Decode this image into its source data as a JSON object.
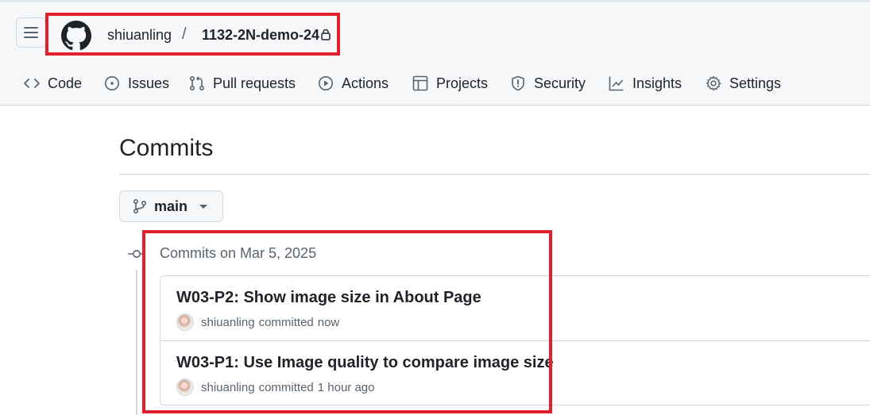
{
  "header": {
    "owner": "shiuanling",
    "separator": "/",
    "repo": "1132-2N-demo-24",
    "nav_tabs": [
      {
        "label": "Code",
        "icon": "code-icon"
      },
      {
        "label": "Issues",
        "icon": "issue-opened-icon"
      },
      {
        "label": "Pull requests",
        "icon": "git-pull-request-icon"
      },
      {
        "label": "Actions",
        "icon": "play-icon"
      },
      {
        "label": "Projects",
        "icon": "table-icon"
      },
      {
        "label": "Security",
        "icon": "shield-icon"
      },
      {
        "label": "Insights",
        "icon": "graph-icon"
      },
      {
        "label": "Settings",
        "icon": "gear-icon"
      }
    ]
  },
  "main": {
    "title": "Commits",
    "branch": "main",
    "commit_groups": [
      {
        "label": "Commits on Mar 5, 2025",
        "commits": [
          {
            "title": "W03-P2: Show image size in About Page",
            "author": "shiuanling",
            "action": "committed",
            "time": "now"
          },
          {
            "title": "W03-P1: Use Image quality to compare image size",
            "author": "shiuanling",
            "action": "committed",
            "time": "1 hour ago"
          }
        ]
      }
    ]
  },
  "colors": {
    "highlight_box": "#e0202c",
    "header_bg": "#f6f8fa",
    "muted_text": "#59636e",
    "border": "#d1d9e0"
  }
}
